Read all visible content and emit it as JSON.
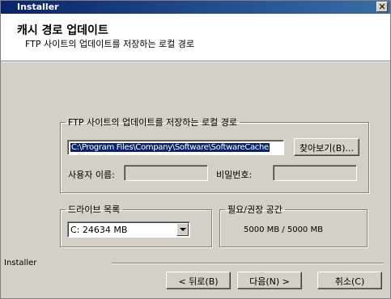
{
  "window": {
    "title": "Installer",
    "close_glyph": "✕"
  },
  "header": {
    "title": "캐시 경로 업데이트",
    "subtitle": "FTP 사이트의 업데이트를 저장하는 로컬 경로"
  },
  "ftp_group": {
    "legend": "FTP 사이트의 업데이트를 저장하는 로컬 경로",
    "path_value": "C:\\Program Files\\Company\\Software\\SoftwareCache",
    "browse_button": "찾아보기(B)...",
    "username_label": "사용자 이름:",
    "username_value": "",
    "password_label": "비밀번호:",
    "password_value": ""
  },
  "drive_group": {
    "legend": "드라이브 목록",
    "selected": "C:  24634 MB"
  },
  "space_group": {
    "legend": "필요/권장 공간",
    "value": "5000 MB / 5000 MB"
  },
  "footer": {
    "brand": "Installer",
    "back_button": "< 뒤로(B)",
    "next_button": "다음(N) >",
    "cancel_button": "취소(C)"
  }
}
